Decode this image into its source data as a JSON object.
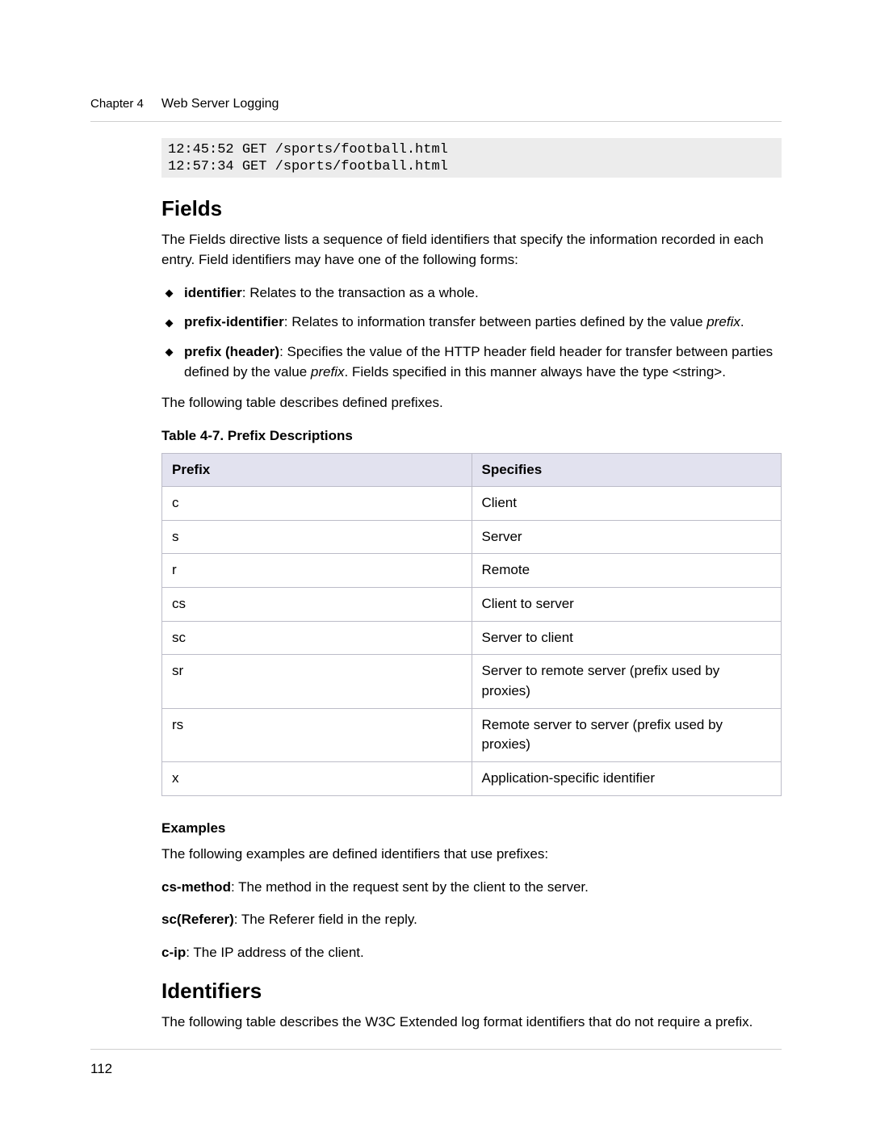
{
  "header": {
    "chapter": "Chapter 4",
    "title": "Web Server Logging"
  },
  "code_block": "12:45:52 GET /sports/football.html\n12:57:34 GET /sports/football.html",
  "section_fields": {
    "heading": "Fields",
    "intro": "The Fields directive lists a sequence of field identifiers that specify the information recorded in each entry. Field identifiers may have one of the following forms:",
    "bullets": [
      {
        "term": "identifier",
        "desc": ": Relates to the transaction as a whole.",
        "has_prefix_italic": false
      },
      {
        "term": "prefix-identifier",
        "desc_pre": ": Relates to information transfer between parties defined by the value ",
        "desc_italic": "prefix",
        "desc_post": "."
      },
      {
        "term": "prefix (header)",
        "desc_pre": ": Specifies the value of the HTTP header field header for transfer between parties defined by the value ",
        "desc_italic": "prefix",
        "desc_post": ". Fields specified in this manner always have the type <string>."
      }
    ],
    "after_bullets": "The following table describes defined prefixes.",
    "table_caption": "Table 4-7. Prefix Descriptions",
    "table_headers": [
      "Prefix",
      "Specifies"
    ],
    "table_rows": [
      {
        "prefix": "c",
        "spec": "Client"
      },
      {
        "prefix": "s",
        "spec": "Server"
      },
      {
        "prefix": "r",
        "spec": "Remote"
      },
      {
        "prefix": "cs",
        "spec": "Client to server"
      },
      {
        "prefix": "sc",
        "spec": "Server to client"
      },
      {
        "prefix": "sr",
        "spec": "Server to remote server (prefix used by proxies)"
      },
      {
        "prefix": "rs",
        "spec": "Remote server to server (prefix used by proxies)"
      },
      {
        "prefix": "x",
        "spec": "Application-specific identifier"
      }
    ],
    "examples_heading": "Examples",
    "examples_intro": "The following examples are defined identifiers that use prefixes:",
    "examples": [
      {
        "term": "cs-method",
        "desc": ": The method in the request sent by the client to the server."
      },
      {
        "term": "sc(Referer)",
        "desc": ": The Referer field in the reply."
      },
      {
        "term": "c-ip",
        "desc": ": The IP address of the client."
      }
    ]
  },
  "section_identifiers": {
    "heading": "Identifiers",
    "intro": "The following table describes the W3C Extended log format identifiers that do not require a prefix."
  },
  "footer": {
    "page_number": "112"
  }
}
